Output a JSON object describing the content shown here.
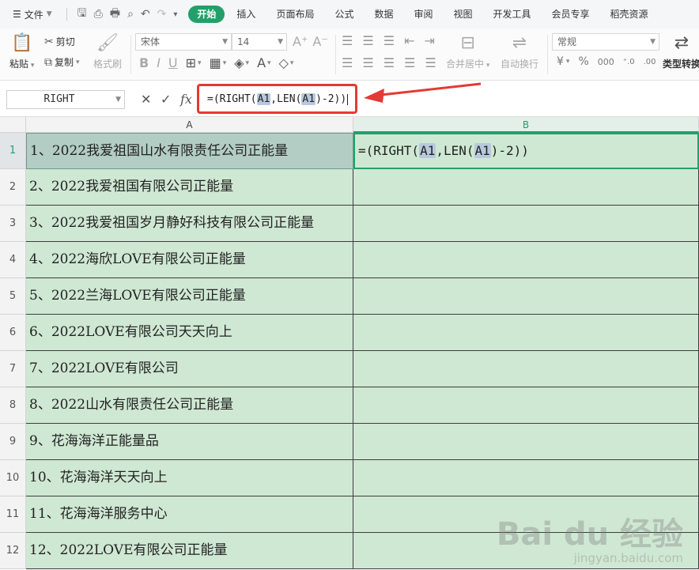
{
  "menubar": {
    "file_label": "文件",
    "tabs": [
      "开始",
      "插入",
      "页面布局",
      "公式",
      "数据",
      "审阅",
      "视图",
      "开发工具",
      "会员专享",
      "稻壳资源"
    ],
    "active_tab": 0,
    "accent_color": "#22a06b"
  },
  "ribbon": {
    "paste_label": "粘贴",
    "cut_label": "剪切",
    "copy_label": "复制",
    "format_painter_label": "格式刷",
    "font_name": "宋体",
    "font_size": "14",
    "merge_label": "合并居中",
    "wrap_label": "自动换行",
    "number_format": "常规",
    "convert_label": "类型转换"
  },
  "formula_bar": {
    "name_box": "RIGHT",
    "formula_prefix": "=(RIGHT(",
    "ref1": "A1",
    "formula_mid": ",LEN(",
    "ref2": "A1",
    "formula_suffix": ")-2))",
    "annotation_color": "#e53935"
  },
  "columns": [
    "A",
    "B"
  ],
  "rows": [
    {
      "num": "1",
      "a": "1、2022我爱祖国山水有限责任公司正能量"
    },
    {
      "num": "2",
      "a": "2、2022我爱祖国有限公司正能量"
    },
    {
      "num": "3",
      "a": "3、2022我爱祖国岁月静好科技有限公司正能量"
    },
    {
      "num": "4",
      "a": "4、2022海欣LOVE有限公司正能量"
    },
    {
      "num": "5",
      "a": "5、2022兰海LOVE有限公司正能量"
    },
    {
      "num": "6",
      "a": "6、2022LOVE有限公司天天向上"
    },
    {
      "num": "7",
      "a": "7、2022LOVE有限公司"
    },
    {
      "num": "8",
      "a": "8、2022山水有限责任公司正能量"
    },
    {
      "num": "9",
      "a": "9、花海海洋正能量品"
    },
    {
      "num": "10",
      "a": "10、花海海洋天天向上"
    },
    {
      "num": "11",
      "a": "11、花海海洋服务中心"
    },
    {
      "num": "12",
      "a": "12、2022LOVE有限公司正能量"
    }
  ],
  "active_cell": {
    "prefix": "=(RIGHT(",
    "ref1": "A1",
    "mid": ",LEN(",
    "ref2": "A1",
    "suffix": ")-2))"
  },
  "watermark": {
    "brand": "Bai du 经验",
    "site": "jingyan.baidu.com"
  }
}
